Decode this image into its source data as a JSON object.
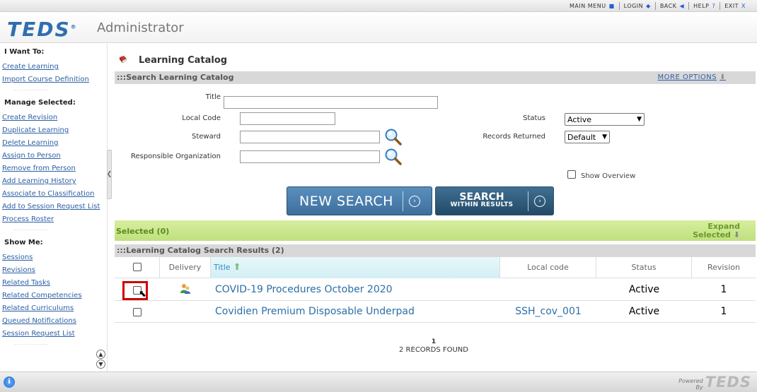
{
  "topnav": {
    "links": [
      {
        "label": "MAIN MENU",
        "icon": "■"
      },
      {
        "label": "LOGIN",
        "icon": "◆"
      },
      {
        "label": "BACK",
        "icon": "◀"
      },
      {
        "label": "HELP",
        "icon": "?"
      },
      {
        "label": "EXIT",
        "icon": "X"
      }
    ]
  },
  "header": {
    "logo": "TEDS",
    "logo_mark": "®",
    "subtitle": "Administrator"
  },
  "sidebar": {
    "want_heading": "I Want To:",
    "want_items": [
      "Create Learning",
      "Import Course Definition"
    ],
    "manage_heading": "Manage Selected:",
    "manage_items": [
      "Create Revision",
      "Duplicate Learning",
      "Delete Learning",
      "Assign to Person",
      "Remove from Person",
      "Add Learning History",
      "Associate to Classification",
      "Add to Session Request List",
      "Process Roster"
    ],
    "show_heading": "Show Me:",
    "show_items": [
      "Sessions",
      "Revisions",
      "Related Tasks",
      "Related Competencies",
      "Related Curriculums",
      "Queued Notifications",
      "Session Request List"
    ],
    "dots": "..............",
    "collapse_glyph": "❮",
    "scroll_up": "▲",
    "scroll_down": "▼"
  },
  "main": {
    "page_title": "Learning Catalog",
    "search_section_title": ":::Search Learning Catalog",
    "more_options": "MORE OPTIONS",
    "more_arrow": "⬇",
    "form": {
      "title_label": "Title",
      "title_value": "",
      "local_code_label": "Local Code",
      "local_code_value": "",
      "steward_label": "Steward",
      "steward_value": "",
      "org_label": "Responsible Organization",
      "org_value": "",
      "status_label": "Status",
      "status_value": "Active",
      "records_label": "Records Returned",
      "records_value": "Default",
      "show_overview_label": "Show Overview"
    },
    "new_search": "NEW SEARCH",
    "search_within_1": "SEARCH",
    "search_within_2": "WITHIN RESULTS",
    "selected_label": "Selected (0)",
    "expand_1": "Expand",
    "expand_2": "Selected",
    "results_title": ":::Learning Catalog Search Results (2)",
    "columns": {
      "delivery": "Delivery",
      "title": "Title",
      "local_code": "Local code",
      "status": "Status",
      "revision": "Revision"
    },
    "rows": [
      {
        "title": "COVID-19 Procedures October 2020",
        "local_code": "",
        "status": "Active",
        "revision": "1",
        "has_delivery_icon": true
      },
      {
        "title": "Covidien Premium Disposable Underpad",
        "local_code": "SSH_cov_001",
        "status": "Active",
        "revision": "1",
        "has_delivery_icon": false
      }
    ],
    "page_number": "1",
    "records_found": "2 RECORDS FOUND"
  },
  "footer": {
    "info": "i",
    "powered_1": "Powered",
    "powered_2": "By",
    "powered_logo": "TEDS"
  },
  "colors": {
    "link": "#2c5fa5",
    "accent_blue": "#2f6fb0",
    "selected_green": "#c7e38a",
    "highlight_red": "#cc0000"
  }
}
